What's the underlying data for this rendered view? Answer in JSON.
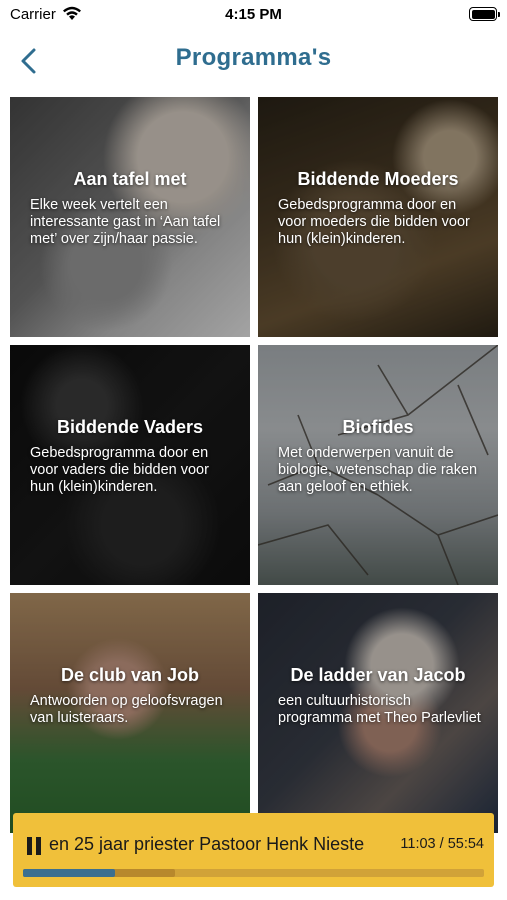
{
  "status_bar": {
    "carrier": "Carrier",
    "time": "4:15 PM"
  },
  "nav": {
    "back_icon": "chevron-left-icon",
    "title": "Programma's",
    "title_color": "#2f6d8f"
  },
  "programs": [
    {
      "name": "Aan tafel met",
      "description": "Elke week vertelt een interessante gast in ‘Aan tafel met’ over zijn/haar passie."
    },
    {
      "name": "Biddende Moeders",
      "description": "Gebedsprogramma door en voor moeders die bidden voor hun (klein)kinderen."
    },
    {
      "name": "Biddende Vaders",
      "description": "Gebedsprogramma door en voor vaders die bidden voor hun (klein)kinderen."
    },
    {
      "name": "Biofides",
      "description": "Met onderwerpen vanuit de biologie, wetenschap die raken aan geloof en ethiek."
    },
    {
      "name": "De club van Job",
      "description": "Antwoorden op geloofsvragen van luisteraars."
    },
    {
      "name": "De ladder van Jacob",
      "description": "een cultuurhistorisch programma met Theo Parlevliet"
    }
  ],
  "player": {
    "state_icon": "pause-icon",
    "now_playing": "en 25 jaar priester Pastoor Henk Nieste",
    "time": "11:03 / 55:54",
    "progress_fraction": 0.2,
    "buffered_fraction": 0.33,
    "background_color": "#f0c03a",
    "progress_color": "#3c6f8f"
  }
}
